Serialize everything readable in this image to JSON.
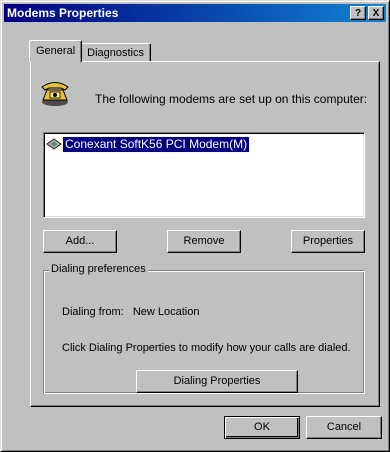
{
  "window": {
    "title": "Modems Properties",
    "help_btn": "?",
    "close_btn": "X"
  },
  "tabs": [
    {
      "label": "General",
      "active": true
    },
    {
      "label": "Diagnostics",
      "active": false
    }
  ],
  "intro_text": "The following modems are set up on this computer:",
  "modems": [
    {
      "name": "Conexant SoftK56 PCI Modem(M)",
      "selected": true
    }
  ],
  "buttons": {
    "add": "Add...",
    "remove": "Remove",
    "properties": "Properties"
  },
  "dialing": {
    "group_label": "Dialing preferences",
    "from_label": "Dialing from:",
    "from_value": "New Location",
    "note": "Click Dialing Properties to modify how your calls are dialed.",
    "dialing_properties_button": "Dialing Properties"
  },
  "footer": {
    "ok": "OK",
    "cancel": "Cancel"
  },
  "colors": {
    "titlebar": "#000080",
    "selection": "#000080",
    "face": "#c0c0c0"
  }
}
